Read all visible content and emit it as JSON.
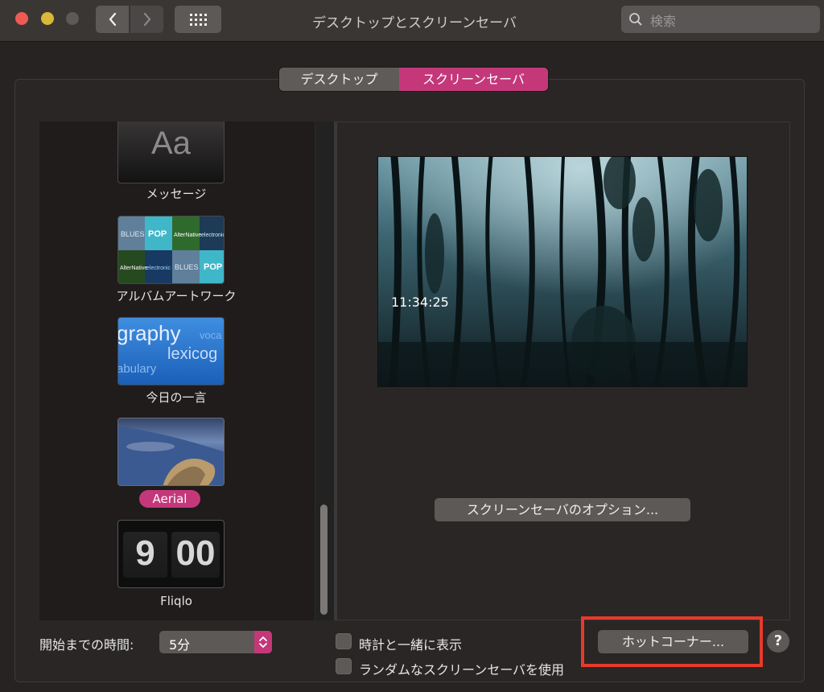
{
  "window": {
    "title": "デスクトップとスクリーンセーバ",
    "search_placeholder": "検索"
  },
  "tabs": [
    {
      "label": "デスクトップ",
      "selected": false
    },
    {
      "label": "スクリーンセーバ",
      "selected": true
    }
  ],
  "savers": [
    {
      "label": "メッセージ",
      "thumb_text": "Aa"
    },
    {
      "label": "アルバムアートワーク"
    },
    {
      "label": "今日の一言",
      "thumb_words": [
        "graphy",
        "lexicog",
        "abulary",
        "voca"
      ]
    },
    {
      "label": "Aerial",
      "selected": true
    },
    {
      "label": "Fliqlo",
      "thumb_digits": [
        "9",
        "00"
      ]
    }
  ],
  "album_tiles": [
    "BLUES",
    "POP",
    "AlterNative",
    "electronic",
    "AlterNative",
    "electronic",
    "BLUES",
    "POP"
  ],
  "preview": {
    "clock": "11:34:25"
  },
  "options_button": "スクリーンセーバのオプション...",
  "start_after": {
    "label": "開始までの時間:",
    "value": "5分"
  },
  "checkboxes": [
    {
      "label": "時計と一緒に表示",
      "checked": false
    },
    {
      "label": "ランダムなスクリーンセーバを使用",
      "checked": false
    }
  ],
  "hot_corners_button": "ホットコーナー...",
  "help_button": "?",
  "colors": {
    "accent": "#c4387a",
    "highlight": "#e83a2a"
  }
}
